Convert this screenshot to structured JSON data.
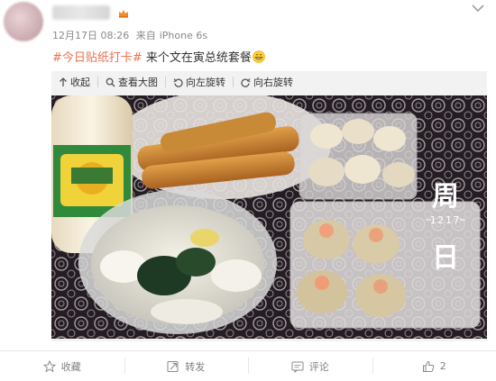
{
  "post": {
    "time": "12月17日 08:26",
    "source_prefix": "来自",
    "source_device": "iPhone 6s",
    "hashtag": "#今日贴纸打卡#",
    "text": " 来个文在寅总统套餐"
  },
  "media_toolbar": {
    "collapse_label": "收起",
    "view_large_label": "查看大图",
    "rotate_left_label": "向左旋转",
    "rotate_right_label": "向右旋转"
  },
  "photo_sticker": {
    "top_char": "周",
    "date": "1217",
    "bottom_char": "日"
  },
  "actions": {
    "favorite_label": "收藏",
    "repost_label": "转发",
    "comment_label": "评论",
    "like_count": "2"
  },
  "icons": {
    "vip": "crown-icon",
    "more": "chevron-down-icon",
    "collapse": "arrow-up-icon",
    "view_large": "magnifier-icon",
    "rotate_left": "rotate-left-icon",
    "rotate_right": "rotate-right-icon",
    "favorite": "star-icon",
    "repost": "repost-icon",
    "comment": "comment-icon",
    "like": "thumb-up-icon"
  },
  "colors": {
    "hashtag": "#eb7350",
    "meta_text": "#8a8a8a",
    "vip_badge": "#f08a24"
  }
}
